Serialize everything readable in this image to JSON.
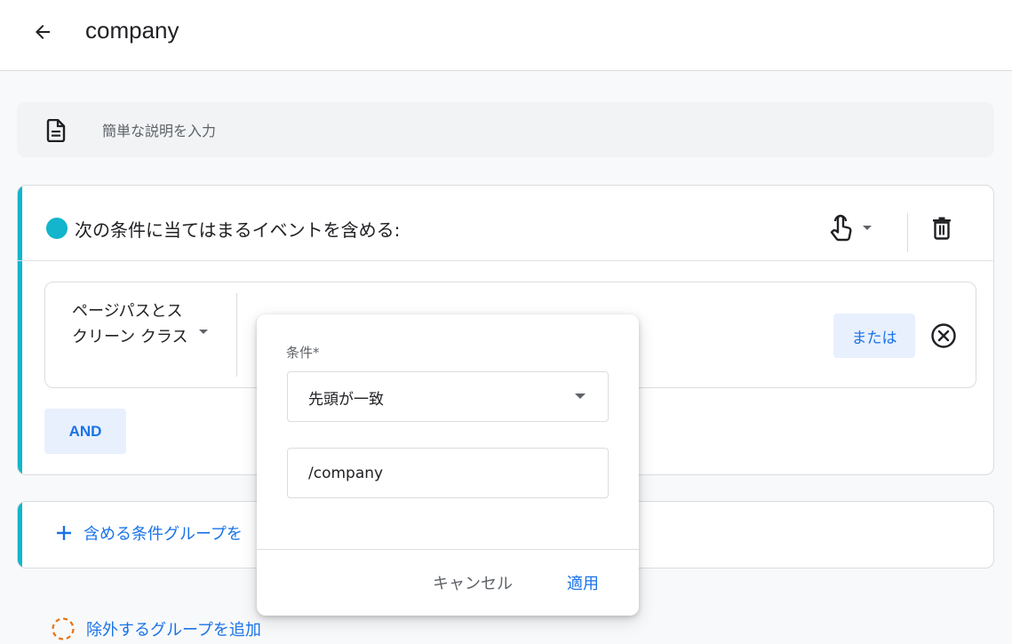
{
  "header": {
    "title": "company",
    "back_icon": "arrow-left-icon"
  },
  "description": {
    "placeholder": "簡単な説明を入力",
    "icon": "document-icon"
  },
  "include_group": {
    "accent_color": "#12b5cb",
    "header_text": "次の条件に当てはまるイベントを含める:",
    "condition": {
      "dimension_label": "ページパスとスクリーン クラス",
      "or_label": "または"
    },
    "and_label": "AND"
  },
  "add_include_group_label": "含める条件グループを",
  "add_exclude_group_label": "除外するグループを追加",
  "popover": {
    "condition_label": "条件*",
    "match_type": "先頭が一致",
    "value": "/company",
    "cancel_label": "キャンセル",
    "apply_label": "適用"
  },
  "colors": {
    "accent": "#12b5cb",
    "link": "#1a73e8"
  }
}
